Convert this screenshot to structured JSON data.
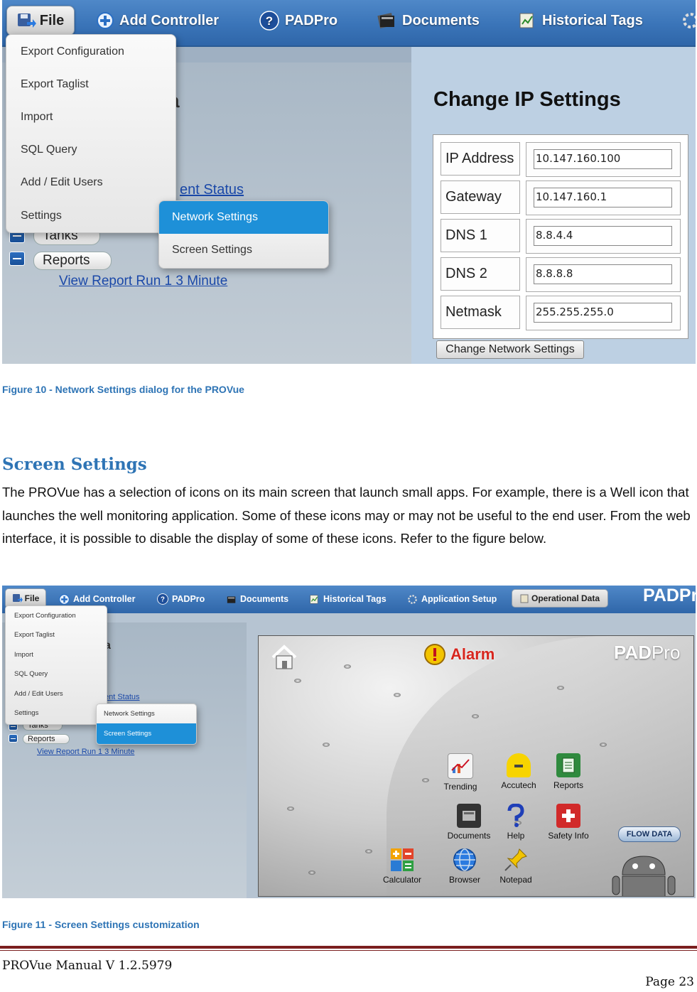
{
  "figure10": {
    "toolbar": {
      "file": "File",
      "add_controller": "Add Controller",
      "padpro": "PADPro",
      "documents": "Documents",
      "historical_tags": "Historical Tags"
    },
    "file_menu": [
      "Export Configuration",
      "Export Taglist",
      "Import",
      "SQL Query",
      "Add / Edit Users",
      "Settings"
    ],
    "settings_submenu": {
      "items": [
        "Network Settings",
        "Screen Settings"
      ],
      "active": "Network Settings"
    },
    "background": {
      "partial_heading": "a",
      "partial_link": "ent Status",
      "tree_tanks": "Tanks",
      "tree_reports": "Reports",
      "report_link": "View Report Run 1 3 Minute"
    },
    "ip_settings": {
      "title": "Change IP Settings",
      "rows": [
        {
          "label": "IP Address",
          "value": "10.147.160.100"
        },
        {
          "label": "Gateway",
          "value": "10.147.160.1"
        },
        {
          "label": "DNS 1",
          "value": "8.8.4.4"
        },
        {
          "label": "DNS 2",
          "value": "8.8.8.8"
        },
        {
          "label": "Netmask",
          "value": "255.255.255.0"
        }
      ],
      "button": "Change Network Settings"
    }
  },
  "caption10": "Figure 10 - Network Settings dialog for the PROVue",
  "section": {
    "heading": "Screen Settings",
    "body": "The PROVue has a selection of icons on its main screen that launch small apps.  For example, there is a Well icon that launches the well monitoring application.  Some of these icons may or may not be useful to the end user.  From the web interface, it is possible to disable the display of some of these icons.  Refer to the figure below."
  },
  "figure11": {
    "toolbar": {
      "file": "File",
      "add_controller": "Add Controller",
      "padpro": "PADPro",
      "documents": "Documents",
      "historical_tags": "Historical Tags",
      "application_setup": "Application Setup",
      "operational_data": "Operational Data",
      "brand": "PADPr"
    },
    "file_menu": [
      "Export Configuration",
      "Export Taglist",
      "Import",
      "SQL Query",
      "Add / Edit Users",
      "Settings"
    ],
    "settings_submenu": {
      "items": [
        "Network Settings",
        "Screen Settings"
      ],
      "active": "Screen Settings"
    },
    "background": {
      "partial_heading": "a",
      "partial_link": "ent Status",
      "tree_tanks": "Tanks",
      "tree_reports": "Reports",
      "report_link": "View Report Run 1 3 Minute"
    },
    "device_screen": {
      "alarm_label": "Alarm",
      "brand_pad": "PAD",
      "brand_pro": "Pro",
      "flow_data": "FLOW DATA",
      "apps": [
        "Trending",
        "Accutech",
        "Reports",
        "Documents",
        "Help",
        "Safety Info",
        "Calculator",
        "Browser",
        "Notepad"
      ]
    }
  },
  "caption11": "Figure 11 - Screen Settings customization",
  "footer": {
    "manual": "PROVue Manual V 1.2.5979",
    "page": "Page 23"
  },
  "colors": {
    "heading_blue": "#2e74b5",
    "footer_rule": "#7b1f1f",
    "menu_active": "#1e90d8"
  }
}
